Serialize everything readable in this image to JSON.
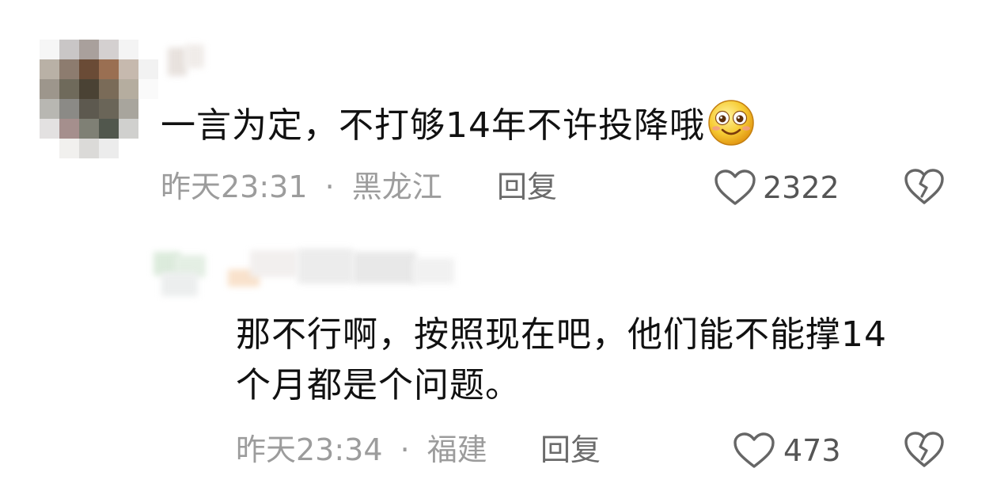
{
  "comments": [
    {
      "text": "一言为定，不打够14年不许投降哦",
      "emoji": "smile-emoji",
      "time": "昨天23:31",
      "separator": "·",
      "location": "黑龙江",
      "reply_label": "回复",
      "likes": "2322"
    },
    {
      "text_line1": "那不行啊，按照现在吧，他们能不能撑14",
      "text_line2": "个月都是个问题。",
      "time": "昨天23:34",
      "separator": "·",
      "location": "福建",
      "reply_label": "回复",
      "likes": "473"
    }
  ],
  "colors": {
    "text": "#111111",
    "meta": "#9c9c9c",
    "icon": "#666666"
  }
}
